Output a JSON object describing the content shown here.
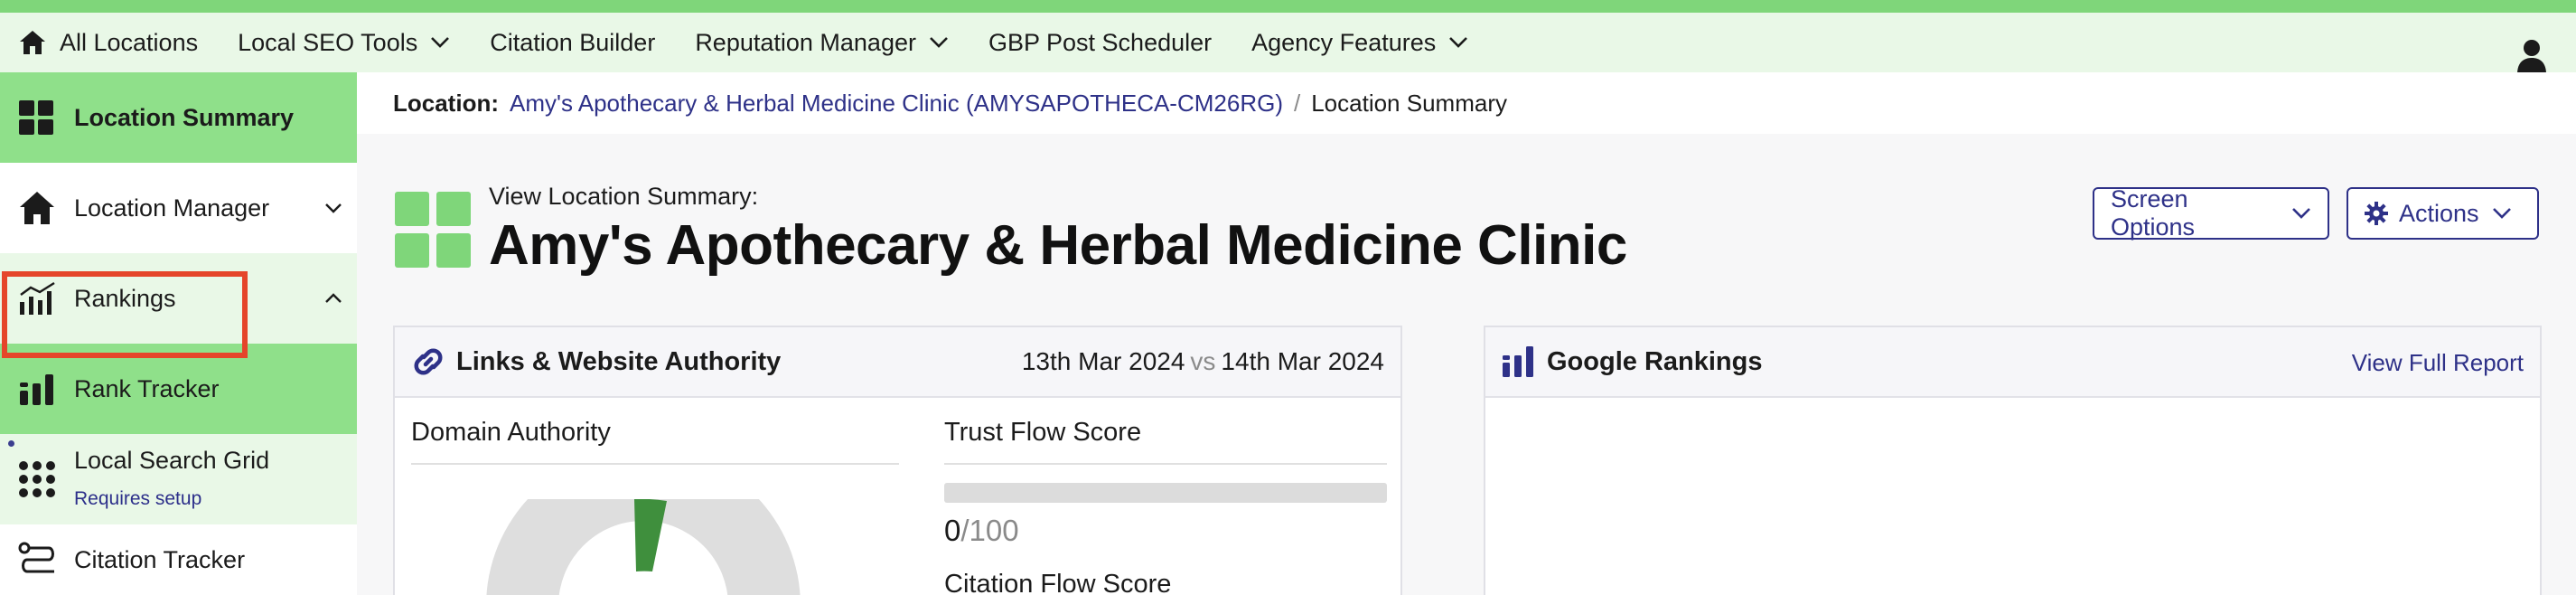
{
  "topnav": {
    "items": [
      {
        "label": "All Locations"
      },
      {
        "label": "Local SEO Tools"
      },
      {
        "label": "Citation Builder"
      },
      {
        "label": "Reputation Manager"
      },
      {
        "label": "GBP Post Scheduler"
      },
      {
        "label": "Agency Features"
      }
    ]
  },
  "sidebar": {
    "items": [
      {
        "label": "Location Summary"
      },
      {
        "label": "Location Manager"
      },
      {
        "label": "Rankings"
      },
      {
        "label": "Rank Tracker"
      },
      {
        "label": "Local Search Grid",
        "sub": "Requires setup"
      },
      {
        "label": "Citation Tracker"
      }
    ]
  },
  "breadcrumb": {
    "key": "Location:",
    "link": "Amy's Apothecary & Herbal Medicine Clinic (AMYSAPOTHECA-CM26RG)",
    "separator": "/",
    "current": "Location Summary"
  },
  "heading": {
    "kicker": "View Location Summary:",
    "title": "Amy's Apothecary & Herbal Medicine Clinic"
  },
  "buttons": {
    "screen_options": "Screen Options",
    "actions": "Actions"
  },
  "links_card": {
    "title": "Links & Website Authority",
    "date_from": "13th Mar 2024",
    "vs": "vs",
    "date_to": "14th Mar 2024",
    "domain_authority_label": "Domain Authority",
    "trust_flow_label": "Trust Flow Score",
    "trust_flow_value": "0",
    "trust_flow_max": "/100",
    "trust_flow_fraction": 0,
    "citation_flow_label": "Citation Flow Score"
  },
  "rank_card": {
    "title": "Google Rankings",
    "view_report": "View Full Report"
  },
  "colors": {
    "accent_green": "#7fd67a",
    "active_green": "#8fe08a",
    "nav_bg": "#e9f8e7",
    "brand_navy": "#2e3188",
    "highlight_red": "#e5452a",
    "donut_green": "#3f8f3d"
  }
}
